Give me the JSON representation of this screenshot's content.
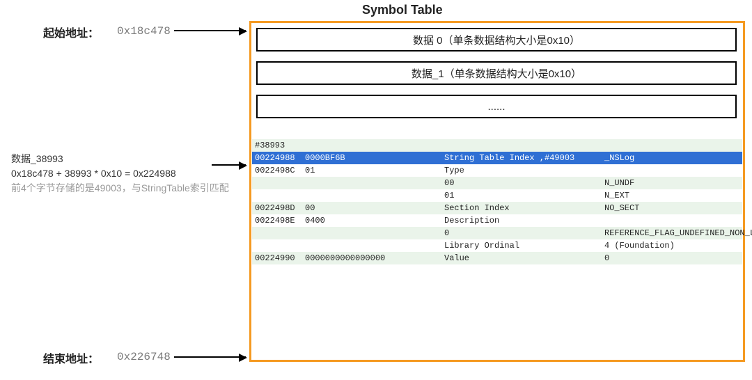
{
  "title": "Symbol Table",
  "start_label": "起始地址：",
  "start_addr": "0x18c478",
  "end_label": "结束地址：",
  "end_addr": "0x226748",
  "rows": {
    "r0": "数据  0（单条数据结构大小是0x10）",
    "r1": "数据_1（单条数据结构大小是0x10）",
    "r2": "......"
  },
  "note": {
    "line1": "数据_38993",
    "line2": "0x18c478 + 38993 * 0x10 = 0x224988",
    "line3_gray": "前4个字节存储的是49003，与StringTable索引匹配"
  },
  "hex": {
    "comment": "#38993",
    "rows": [
      {
        "class": "highlight-row",
        "c1": "00224988",
        "c2": "0000BF6B",
        "c4": "String Table Index ,#49003",
        "c5": "_NSLog"
      },
      {
        "class": "alt0",
        "c1": "0022498C",
        "c2": "01",
        "c4": "Type",
        "c5": ""
      },
      {
        "class": "alt1",
        "c1": "",
        "c2": "",
        "c4": "00",
        "c5": "N_UNDF"
      },
      {
        "class": "alt0",
        "c1": "",
        "c2": "",
        "c4": "01",
        "c5": "N_EXT"
      },
      {
        "class": "alt1",
        "c1": "0022498D",
        "c2": "00",
        "c4": "Section Index",
        "c5": "NO_SECT"
      },
      {
        "class": "alt0",
        "c1": "0022498E",
        "c2": "0400",
        "c4": "Description",
        "c5": ""
      },
      {
        "class": "alt1",
        "c1": "",
        "c2": "",
        "c4": "0",
        "c5": "REFERENCE_FLAG_UNDEFINED_NON_LAZY"
      },
      {
        "class": "alt0",
        "c1": "",
        "c2": "",
        "c4": "Library Ordinal",
        "c5": "4 (Foundation)"
      },
      {
        "class": "alt1",
        "c1": "00224990",
        "c2": "0000000000000000",
        "c4": "Value",
        "c5": "0"
      }
    ]
  }
}
